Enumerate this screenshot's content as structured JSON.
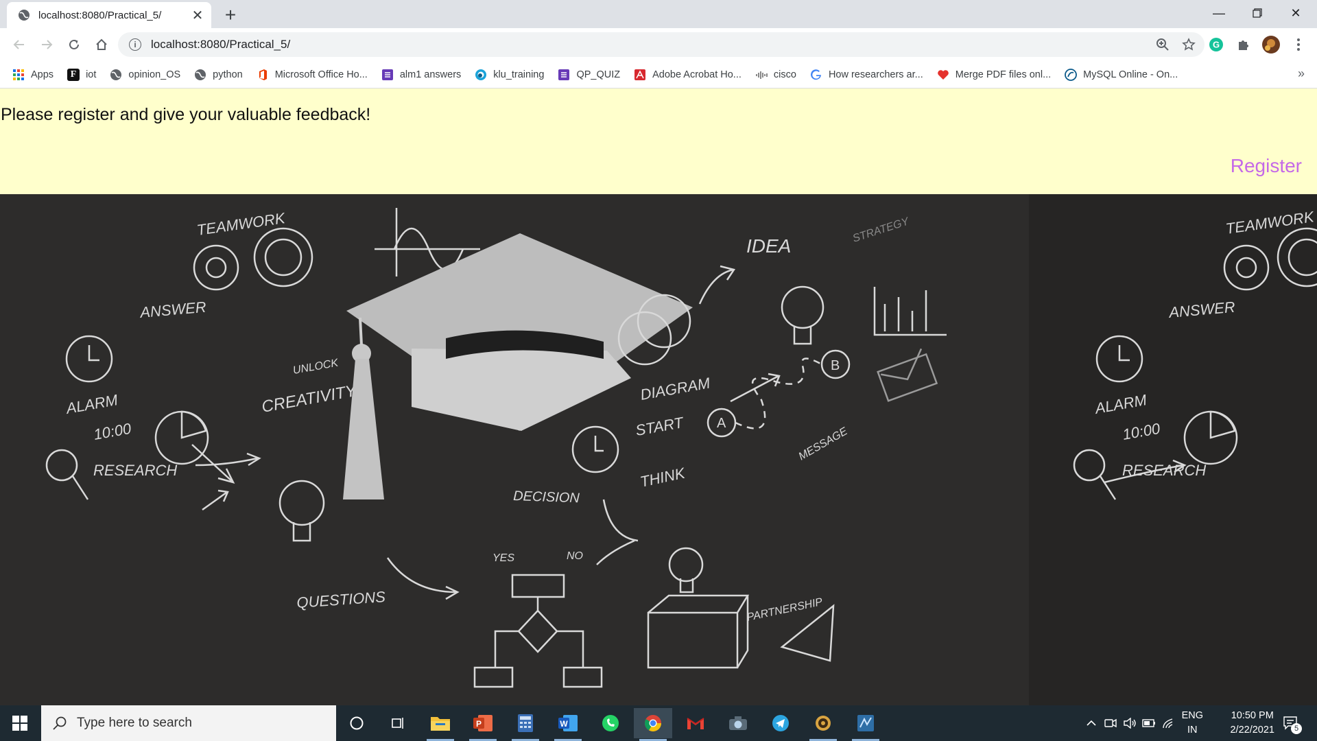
{
  "browser": {
    "tab_title": "localhost:8080/Practical_5/",
    "url": "localhost:8080/Practical_5/",
    "bookmarks": [
      {
        "label": "Apps",
        "icon": "apps-grid-icon"
      },
      {
        "label": "iot",
        "icon": "f-logo-icon"
      },
      {
        "label": "opinion_OS",
        "icon": "globe-icon"
      },
      {
        "label": "python",
        "icon": "globe-icon"
      },
      {
        "label": "Microsoft Office Ho...",
        "icon": "office-icon"
      },
      {
        "label": "alm1 answers",
        "icon": "forms-icon"
      },
      {
        "label": "klu_training",
        "icon": "circle-logo-icon"
      },
      {
        "label": "QP_QUIZ",
        "icon": "forms-icon"
      },
      {
        "label": "Adobe Acrobat Ho...",
        "icon": "acrobat-icon"
      },
      {
        "label": "cisco",
        "icon": "cisco-icon"
      },
      {
        "label": "How researchers ar...",
        "icon": "google-icon"
      },
      {
        "label": "Merge PDF files onl...",
        "icon": "heart-icon"
      },
      {
        "label": "MySQL Online - On...",
        "icon": "mysql-icon"
      }
    ],
    "overflow_label": "»"
  },
  "page": {
    "banner_message": "Please register and give your valuable feedback!",
    "register_label": "Register",
    "banner_color": "#ffffcc",
    "link_color": "#c569e8"
  },
  "board": {
    "words": [
      "TEAMWORK",
      "ANSWER",
      "UNLOCK",
      "ALARM",
      "10:00",
      "CREATIVITY",
      "RESEARCH",
      "QUESTIONS",
      "IDEA",
      "STRATEGY",
      "DIAGRAM",
      "START",
      "THINK",
      "DECISION",
      "YES",
      "NO",
      "MESSAGE",
      "PARTNERSHIP",
      "TEAMWORK",
      "ANSWER",
      "ALARM",
      "10:00",
      "RESEARCH"
    ]
  },
  "taskbar": {
    "search_placeholder": "Type here to search",
    "lang_top": "ENG",
    "lang_bottom": "IN",
    "time": "10:50 PM",
    "date": "2/22/2021",
    "notification_count": "5"
  }
}
